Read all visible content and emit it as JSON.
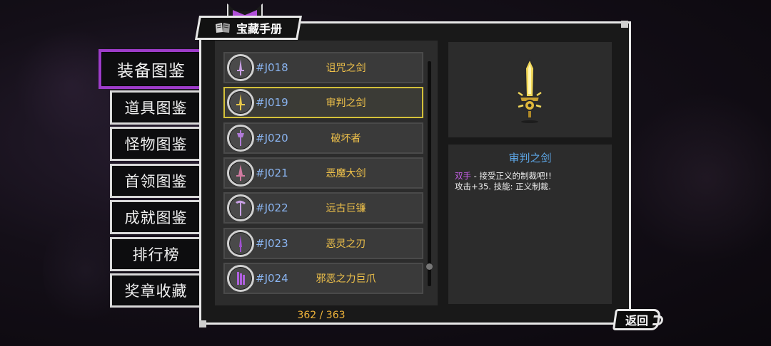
{
  "panel": {
    "title": "宝藏手册"
  },
  "menu": {
    "items": [
      {
        "label": "装备图鉴",
        "active": true
      },
      {
        "label": "道具图鉴",
        "active": false
      },
      {
        "label": "怪物图鉴",
        "active": false
      },
      {
        "label": "首领图鉴",
        "active": false
      },
      {
        "label": "成就图鉴",
        "active": false
      },
      {
        "label": "排行榜",
        "active": false
      },
      {
        "label": "奖章收藏",
        "active": false
      }
    ]
  },
  "list": {
    "rows": [
      {
        "code": "#J018",
        "name": "诅咒之剑",
        "icon": "cursed-sword-icon",
        "color": "#c9a0e6"
      },
      {
        "code": "#J019",
        "name": "审判之剑",
        "icon": "judgment-sword-icon",
        "color": "#e8c84a",
        "selected": true
      },
      {
        "code": "#J020",
        "name": "破坏者",
        "icon": "destroyer-icon",
        "color": "#b07ad8"
      },
      {
        "code": "#J021",
        "name": "恶魔大剑",
        "icon": "demon-greatsword-icon",
        "color": "#d07aa0"
      },
      {
        "code": "#J022",
        "name": "远古巨镰",
        "icon": "ancient-scythe-icon",
        "color": "#c9a0e6"
      },
      {
        "code": "#J023",
        "name": "恶灵之刃",
        "icon": "evil-blade-icon",
        "color": "#a050d0"
      },
      {
        "code": "#J024",
        "name": "邪恶之力巨爪",
        "icon": "evil-claw-icon",
        "color": "#b060e0"
      }
    ],
    "counter": "362 / 363"
  },
  "detail": {
    "name": "审判之剑",
    "tag": "双手",
    "line1_rest": " - 接受正义的制裁吧!!",
    "line2": "攻击+35. 技能: 正义制裁.",
    "image_icon": "golden-sword-icon"
  },
  "back_button": {
    "label": "返回"
  },
  "colors": {
    "accent_purple": "#9d3cc9",
    "selected_border": "#d4c13a",
    "code_blue": "#8ab4f0",
    "name_gold": "#f0c24a"
  }
}
